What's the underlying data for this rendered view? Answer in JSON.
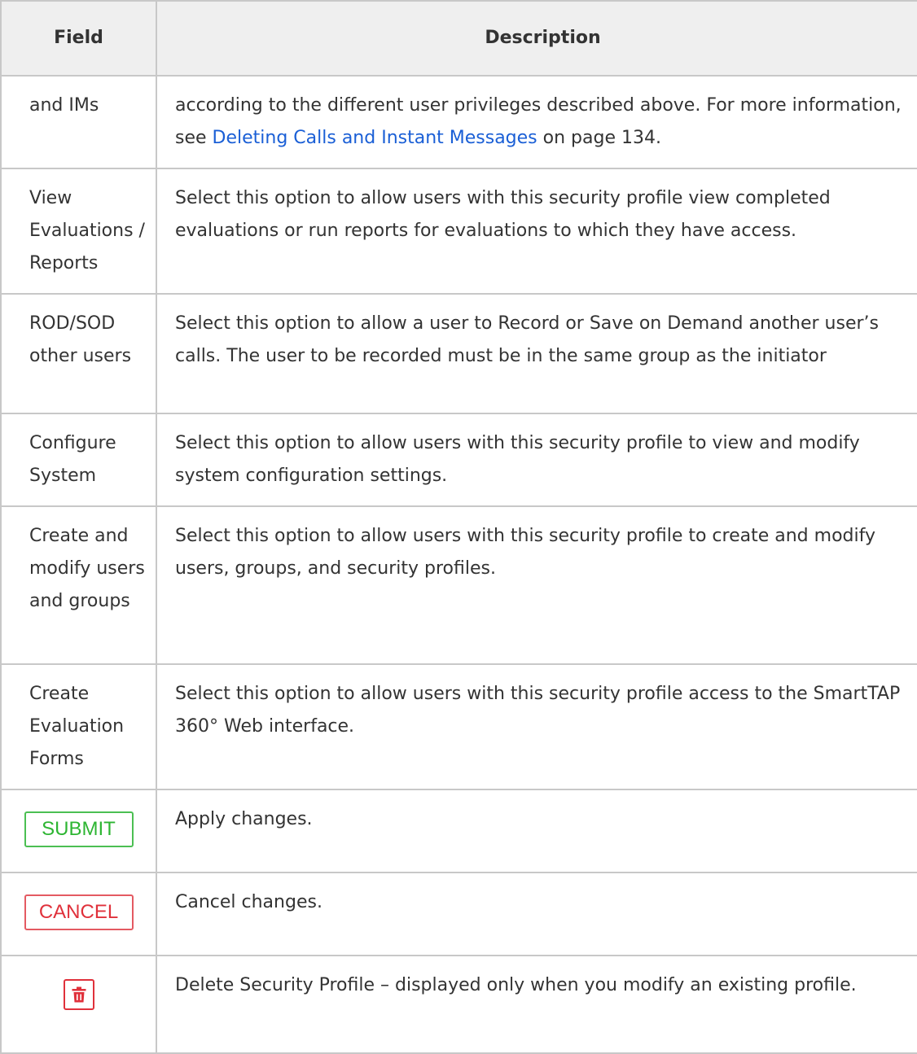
{
  "table": {
    "headers": {
      "field": "Field",
      "description": "Description"
    },
    "rows": [
      {
        "field": "and IMs",
        "desc_before": "according to the different user privileges described above. For more information, see ",
        "desc_link": "Deleting Calls and Instant Messages",
        "desc_after": " on page 134."
      },
      {
        "field": "View Evaluations / Reports",
        "description": "Select this option to allow users with this security profile view completed evaluations or run reports for evaluations to which they have access."
      },
      {
        "field": "ROD/SOD other users",
        "description": "Select this option to allow a user to Record or Save on Demand another user’s calls. The user to be recorded must be in the same group as the initiator"
      },
      {
        "field": "Configure System",
        "description": "Select this option to allow users with this security profile to view and modify system configuration settings."
      },
      {
        "field": "Create and modify users and groups",
        "description": "Select this option to allow users with this security profile to create and modify users, groups, and security profiles."
      },
      {
        "field": "Create Evaluation Forms",
        "description": "Select this option to allow users with this security profile access to the SmartTAP 360° Web interface."
      },
      {
        "button_label": "SUBMIT",
        "description": "Apply changes."
      },
      {
        "button_label": "CANCEL",
        "description": "Cancel changes."
      },
      {
        "button_icon": "trash-icon",
        "description": "Delete Security Profile – displayed only when you modify an existing profile."
      }
    ]
  },
  "colors": {
    "link": "#1a5fd6",
    "submit": "#2db532",
    "cancel": "#e0313b",
    "header_bg": "#efefef",
    "border": "#c8c8c8"
  }
}
